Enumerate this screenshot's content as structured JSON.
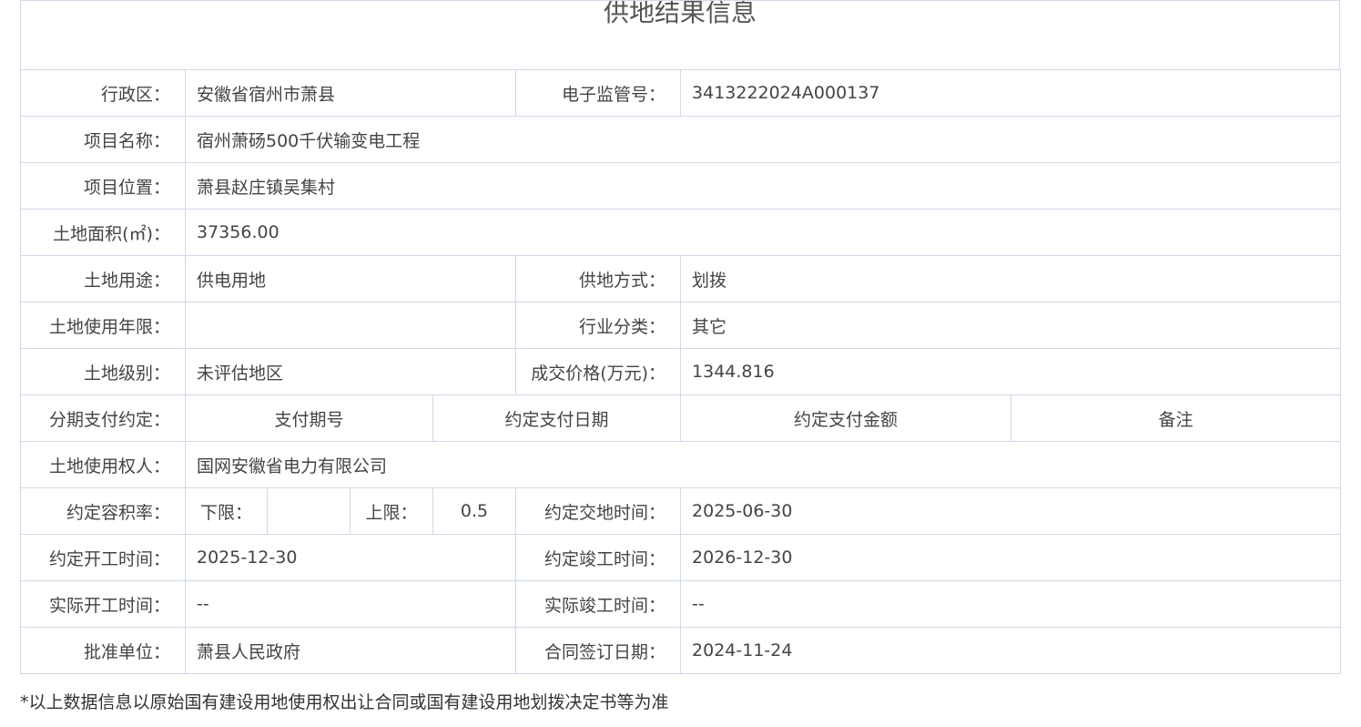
{
  "page_title": "供地结果信息",
  "fields": {
    "region_label": "行政区：",
    "region_value": "安徽省宿州市萧县",
    "supervision_no_label": "电子监管号：",
    "supervision_no_value": "3413222024A000137",
    "project_name_label": "项目名称：",
    "project_name_value": "宿州萧砀500千伏输变电工程",
    "project_location_label": "项目位置：",
    "project_location_value": "萧县赵庄镇吴集村",
    "land_area_label": "土地面积(㎡)：",
    "land_area_value": "37356.00",
    "land_use_label": "土地用途：",
    "land_use_value": "供电用地",
    "supply_method_label": "供地方式：",
    "supply_method_value": "划拨",
    "use_term_label": "土地使用年限：",
    "use_term_value": "",
    "industry_label": "行业分类：",
    "industry_value": "其它",
    "land_grade_label": "土地级别：",
    "land_grade_value": "未评估地区",
    "price_label": "成交价格(万元)：",
    "price_value": "1344.816",
    "installment_label": "分期支付约定：",
    "installment_headers": [
      "支付期号",
      "约定支付日期",
      "约定支付金额",
      "备注"
    ],
    "land_user_label": "土地使用权人：",
    "land_user_value": "国网安徽省电力有限公司",
    "far_label": "约定容积率：",
    "far_lower_label": "下限：",
    "far_lower_value": "",
    "far_upper_label": "上限：",
    "far_upper_value": "0.5",
    "handover_label": "约定交地时间：",
    "handover_value": "2025-06-30",
    "start_label": "约定开工时间：",
    "start_value": "2025-12-30",
    "finish_label": "约定竣工时间：",
    "finish_value": "2026-12-30",
    "actual_start_label": "实际开工时间：",
    "actual_start_value": "--",
    "actual_finish_label": "实际竣工时间：",
    "actual_finish_value": "--",
    "approver_label": "批准单位：",
    "approver_value": "萧县人民政府",
    "sign_date_label": "合同签订日期：",
    "sign_date_value": "2024-11-24"
  },
  "footnote": "*以上数据信息以原始国有建设用地使用权出让合同或国有建设用地划拨决定书等为准",
  "colors": {
    "border": "#cfd9e6",
    "text": "#444444",
    "title": "#555555"
  }
}
